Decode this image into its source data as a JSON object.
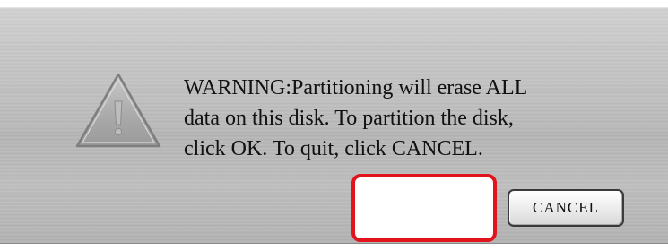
{
  "dialog": {
    "icon": "warning-triangle-icon",
    "message_lines": [
      "WARNING:Partitioning will erase ALL",
      "data on this disk. To partition the disk,",
      "click OK. To quit, click CANCEL."
    ],
    "cancel_label": "CANCEL"
  },
  "colors": {
    "highlight": "#e0141c",
    "panel": "#c4c4c4"
  }
}
